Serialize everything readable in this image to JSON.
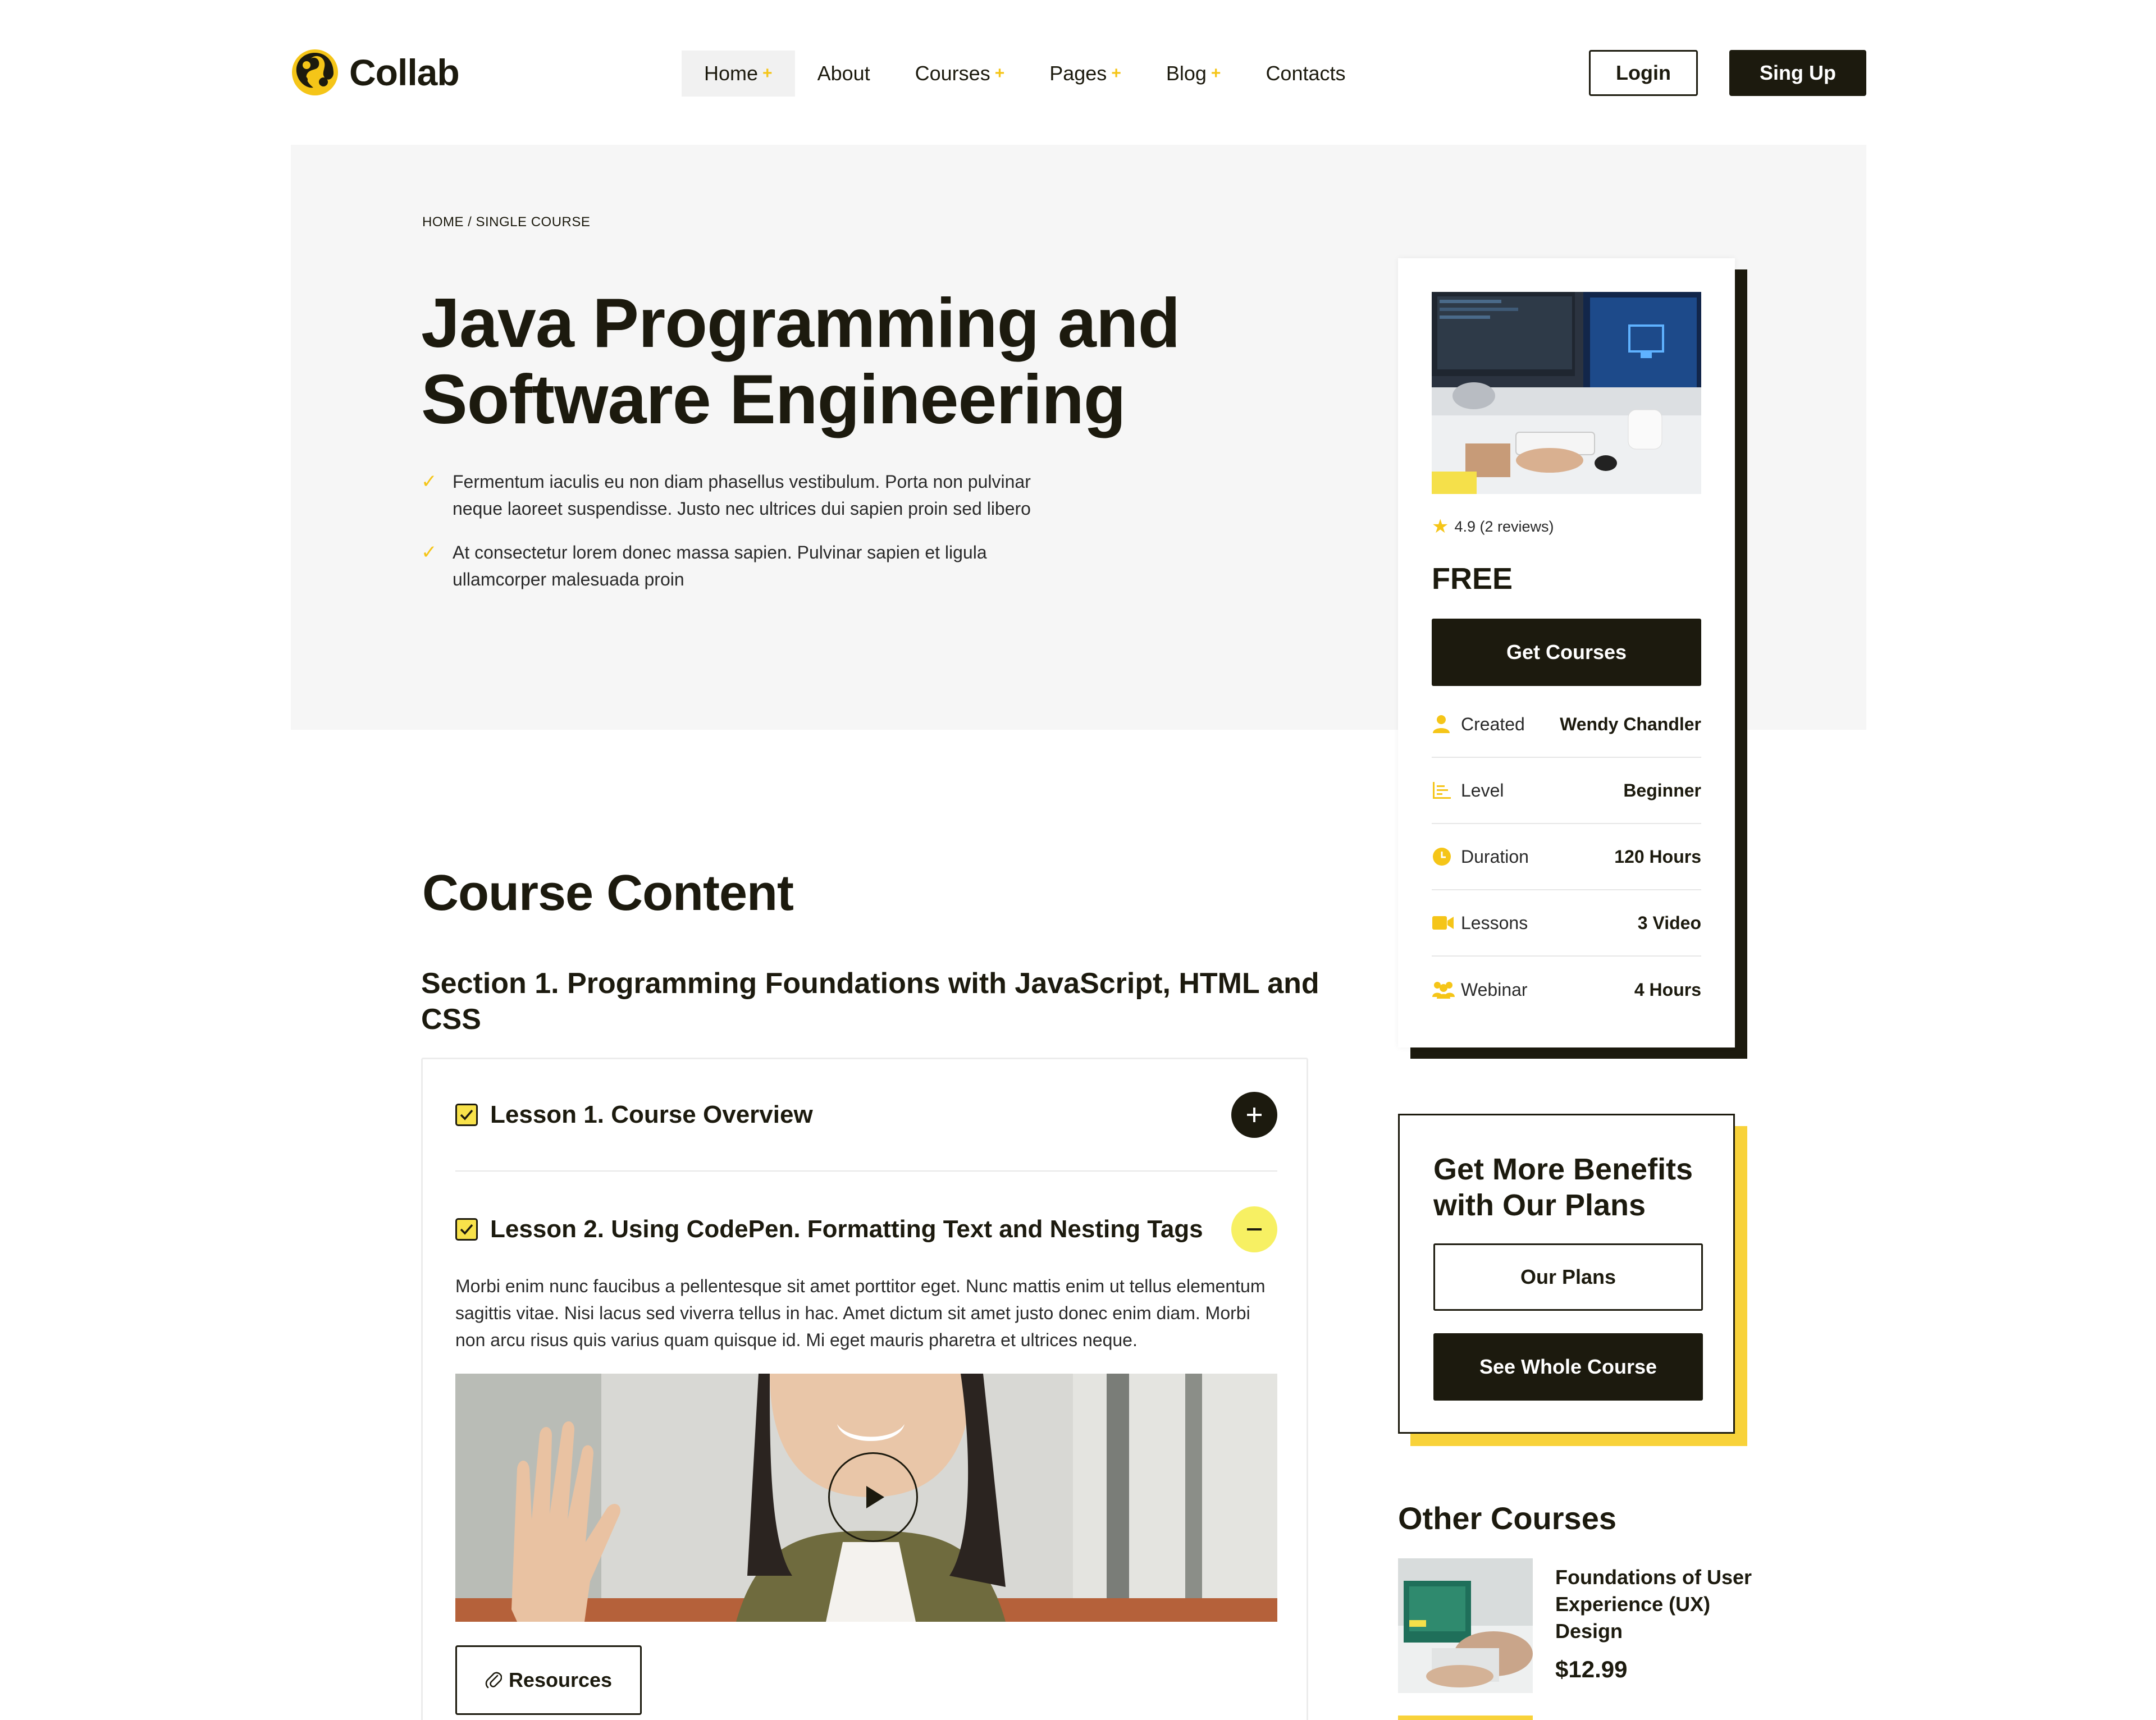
{
  "brand": {
    "name": "Collab",
    "accent": "#f5c518",
    "dark": "#1c1a0e"
  },
  "nav": {
    "items": [
      {
        "label": "Home",
        "plus": "+"
      },
      {
        "label": "About",
        "plus": ""
      },
      {
        "label": "Courses",
        "plus": "+"
      },
      {
        "label": "Pages",
        "plus": "+"
      },
      {
        "label": "Blog",
        "plus": "+"
      },
      {
        "label": "Contacts",
        "plus": ""
      }
    ],
    "login": "Login",
    "signup": "Sing Up"
  },
  "hero": {
    "breadcrumb": "HOME / SINGLE COURSE",
    "title_line1": "Java Programming and",
    "title_line2": "Software Engineering",
    "bullets": [
      "Fermentum iaculis eu non diam phasellus vestibulum. Porta non pulvinar neque laoreet suspendisse. Justo nec ultrices dui sapien proin sed libero",
      "At consectetur lorem donec massa sapien. Pulvinar sapien et ligula ullamcorper malesuada proin"
    ]
  },
  "course_card": {
    "rating": "4.9 (2 reviews)",
    "price": "FREE",
    "cta": "Get Courses",
    "meta": [
      {
        "icon": "user-icon",
        "label": "Created",
        "value": "Wendy Chandler"
      },
      {
        "icon": "level-chart-icon",
        "label": "Level",
        "value": "Beginner"
      },
      {
        "icon": "clock-icon",
        "label": "Duration",
        "value": "120 Hours"
      },
      {
        "icon": "video-camera-icon",
        "label": "Lessons",
        "value": "3 Video"
      },
      {
        "icon": "group-icon",
        "label": "Webinar",
        "value": "4 Hours"
      }
    ]
  },
  "benefits": {
    "title": "Get More Benefits with Our Plans",
    "plans_btn": "Our Plans",
    "whole_btn": "See Whole Course"
  },
  "other_courses": {
    "title": "Other Courses",
    "items": [
      {
        "name": "Foundations of User Experience (UX) Design",
        "price": "$12.99"
      }
    ]
  },
  "content": {
    "title": "Course Content",
    "section_title": "Section 1. Programming Foundations with JavaScript, HTML and CSS",
    "lessons": [
      {
        "name": "Lesson 1. Course Overview",
        "expanded": false
      },
      {
        "name": "Lesson 2. Using CodePen. Formatting Text and Nesting Tags",
        "expanded": true
      }
    ],
    "lesson_desc": "Morbi enim nunc faucibus a pellentesque sit amet porttitor eget. Nunc mattis enim ut tellus elementum sagittis vitae. Nisi lacus sed viverra tellus in hac. Amet dictum sit amet justo donec enim diam. Morbi non arcu risus quis varius quam quisque id. Mi eget mauris pharetra et ultrices neque.",
    "resources_btn": "Resources"
  }
}
